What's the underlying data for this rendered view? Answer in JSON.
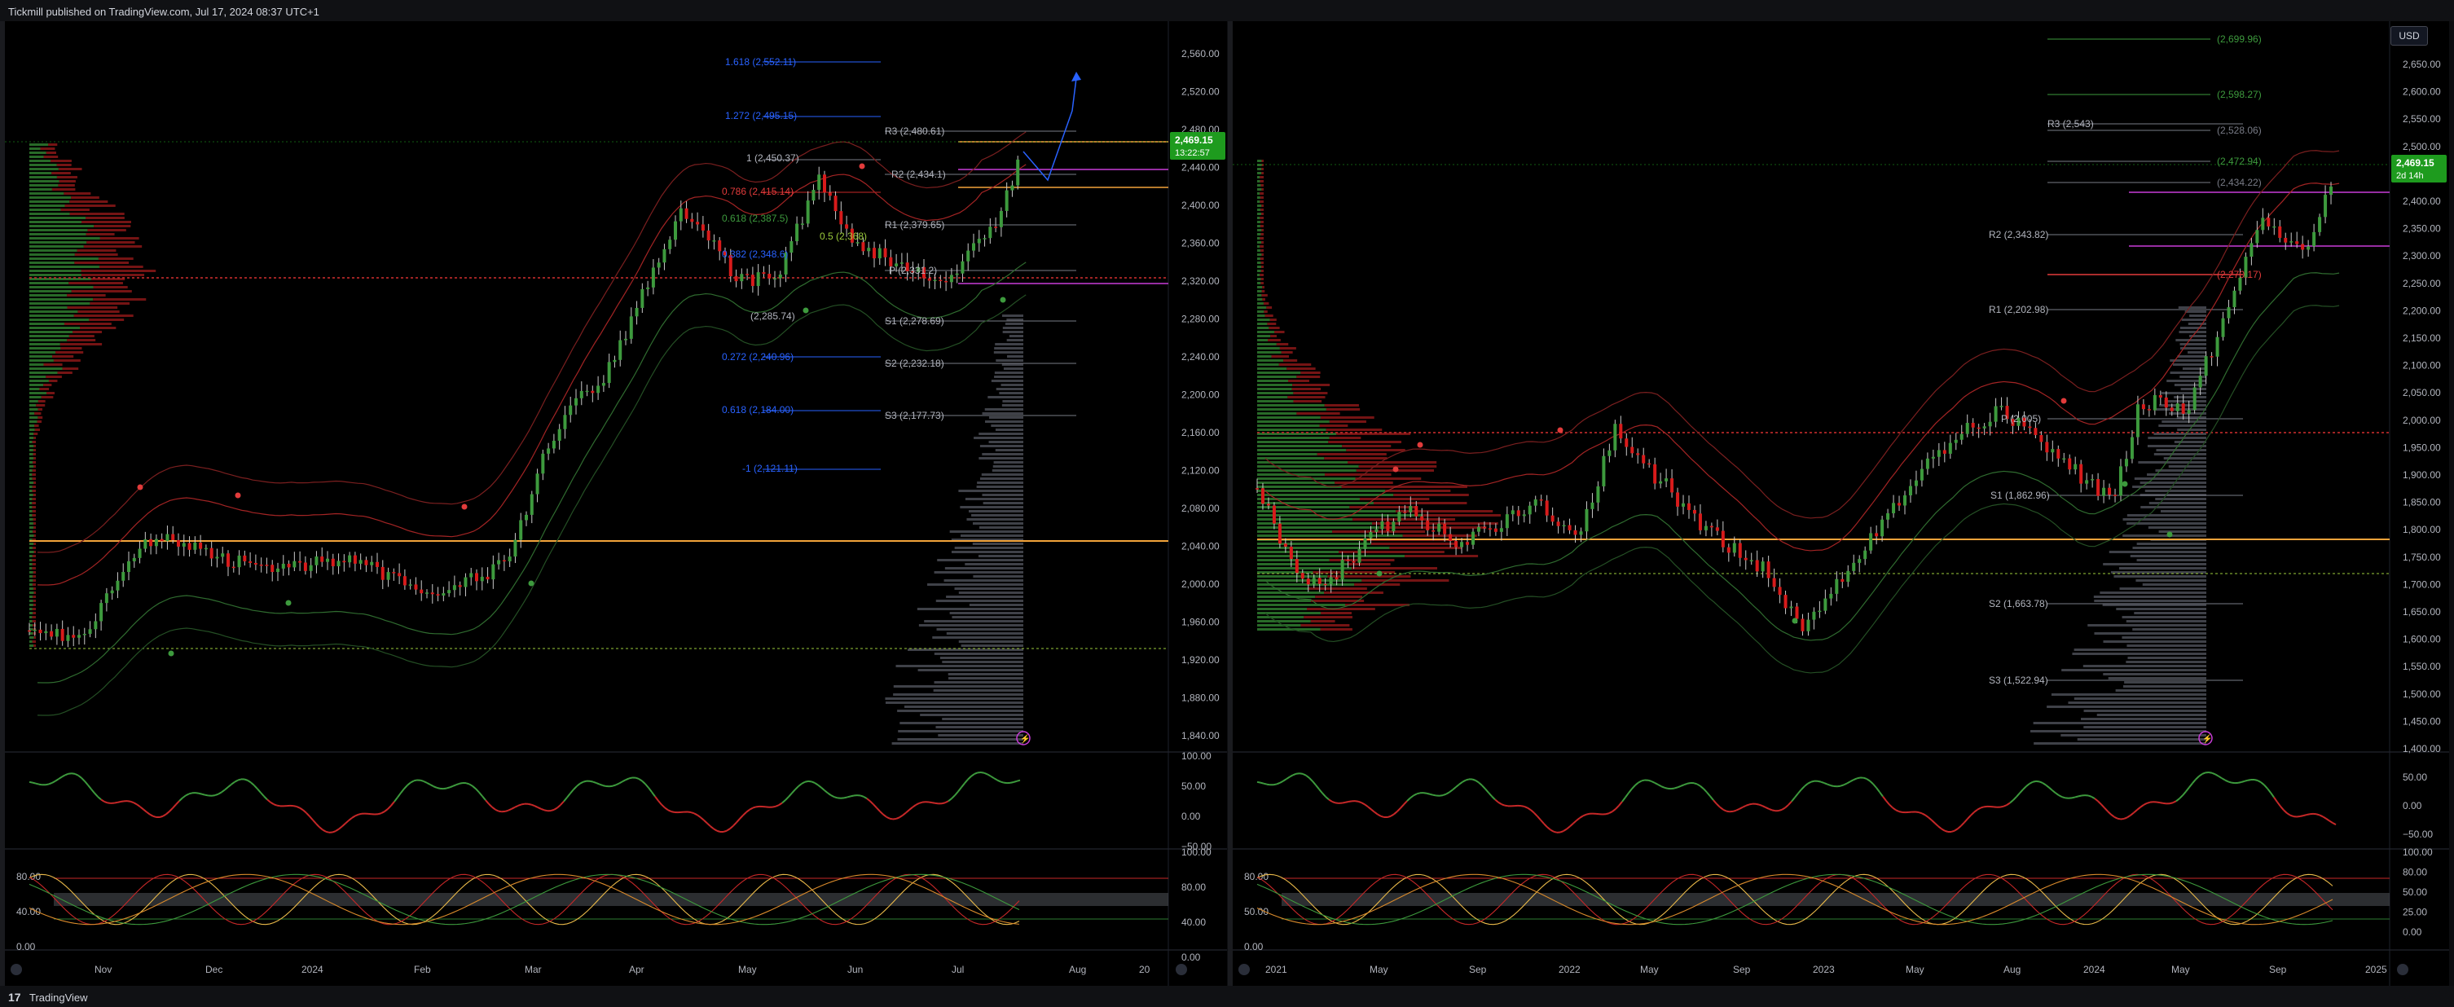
{
  "header": {
    "published_text": "Tickmill published on TradingView.com, Jul 17, 2024 08:37 UTC+1"
  },
  "footer": {
    "logo": "17",
    "brand": "TradingView"
  },
  "currency": "USD",
  "colors": {
    "bull": "#3d9a3d",
    "bear": "#d81b1b",
    "price_badge": "#1e9b1e",
    "pivot_line": "#c8c8c8",
    "fib_text": "#2962ff",
    "resistance_band": "#f2a33a",
    "sr_magenta": "#c83cd8"
  },
  "left_chart": {
    "price_badge": {
      "price": "2,469.15",
      "countdown": "13:22:57"
    },
    "price_axis": [
      "2,560.00",
      "2,520.00",
      "2,480.00",
      "2,440.00",
      "2,400.00",
      "2,360.00",
      "2,320.00",
      "2,280.00",
      "2,240.00",
      "2,200.00",
      "2,160.00",
      "2,120.00",
      "2,080.00",
      "2,040.00",
      "2,000.00",
      "1,960.00",
      "1,920.00",
      "1,880.00",
      "1,840.00"
    ],
    "time_axis": [
      "Nov",
      "Dec",
      "2024",
      "Feb",
      "Mar",
      "Apr",
      "May",
      "Jun",
      "Jul",
      "Aug",
      "20"
    ],
    "fib_labels": [
      "1.618 (2,552.11)",
      "1.272 (2,495.15)",
      "1 (2,450.37)",
      "0.786 (2,415.14)",
      "0.618 (2,387.5)",
      "0.5 (2,368)",
      "0.382 (2,348.6)",
      "(2,285.74)",
      "0.272 (2,240.96)",
      "0.618 (2,184.00)",
      "-1 (2,121.11)"
    ],
    "pivot_labels": [
      "R3 (2,480.61)",
      "R2 (2,434.1)",
      "R1 (2,379.65)",
      "P (2,331.2)",
      "S1 (2,278.69)",
      "S2 (2,232.18)",
      "S3 (2,177.73)"
    ],
    "rsi_axis": [
      "100.00",
      "50.00",
      "0.00",
      "−50.00"
    ],
    "stoch_axis": [
      "100.00",
      "80.00",
      "40.00",
      "0.00"
    ],
    "stoch_left_axis": [
      "80.00",
      "40.00",
      "0.00"
    ]
  },
  "right_chart": {
    "price_badge": {
      "price": "2,469.15",
      "countdown": "2d 14h"
    },
    "price_axis": [
      "2,650.00",
      "2,600.00",
      "2,550.00",
      "2,500.00",
      "2,450.00",
      "2,400.00",
      "2,350.00",
      "2,300.00",
      "2,250.00",
      "2,200.00",
      "2,150.00",
      "2,100.00",
      "2,050.00",
      "2,000.00",
      "1,950.00",
      "1,900.00",
      "1,850.00",
      "1,800.00",
      "1,750.00",
      "1,700.00",
      "1,650.00",
      "1,600.00",
      "1,550.00",
      "1,500.00",
      "1,450.00",
      "1,400.00"
    ],
    "time_axis": [
      "2021",
      "May",
      "Sep",
      "2022",
      "May",
      "Sep",
      "2023",
      "May",
      "Aug",
      "2024",
      "May",
      "Sep",
      "2025"
    ],
    "level_labels": [
      "(2,699.96)",
      "(2,598.27)",
      "(2,528.06)",
      "(2,472.94)",
      "(2,434.22)",
      "(2,270.17)"
    ],
    "pivot_labels": [
      "R3 (2,543)",
      "R2 (2,343.82)",
      "R1 (2,202.98)",
      "P (2,005)",
      "S1 (1,862.96)",
      "S2 (1,663.78)",
      "S3 (1,522.94)"
    ],
    "rsi_axis": [
      "50.00",
      "0.00",
      "−50.00"
    ],
    "stoch_axis": [
      "100.00",
      "80.00",
      "50.00",
      "25.00",
      "0.00"
    ],
    "stoch_left_axis": [
      "80.00",
      "50.00",
      "0.00"
    ]
  }
}
